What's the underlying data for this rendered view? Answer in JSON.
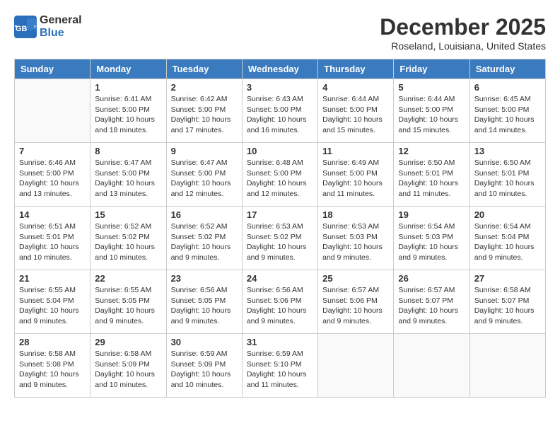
{
  "logo": {
    "general": "General",
    "blue": "Blue"
  },
  "title": {
    "month_year": "December 2025",
    "location": "Roseland, Louisiana, United States"
  },
  "headers": [
    "Sunday",
    "Monday",
    "Tuesday",
    "Wednesday",
    "Thursday",
    "Friday",
    "Saturday"
  ],
  "weeks": [
    [
      {
        "day": "",
        "sunrise": "",
        "sunset": "",
        "daylight": ""
      },
      {
        "day": "1",
        "sunrise": "Sunrise: 6:41 AM",
        "sunset": "Sunset: 5:00 PM",
        "daylight": "Daylight: 10 hours and 18 minutes."
      },
      {
        "day": "2",
        "sunrise": "Sunrise: 6:42 AM",
        "sunset": "Sunset: 5:00 PM",
        "daylight": "Daylight: 10 hours and 17 minutes."
      },
      {
        "day": "3",
        "sunrise": "Sunrise: 6:43 AM",
        "sunset": "Sunset: 5:00 PM",
        "daylight": "Daylight: 10 hours and 16 minutes."
      },
      {
        "day": "4",
        "sunrise": "Sunrise: 6:44 AM",
        "sunset": "Sunset: 5:00 PM",
        "daylight": "Daylight: 10 hours and 15 minutes."
      },
      {
        "day": "5",
        "sunrise": "Sunrise: 6:44 AM",
        "sunset": "Sunset: 5:00 PM",
        "daylight": "Daylight: 10 hours and 15 minutes."
      },
      {
        "day": "6",
        "sunrise": "Sunrise: 6:45 AM",
        "sunset": "Sunset: 5:00 PM",
        "daylight": "Daylight: 10 hours and 14 minutes."
      }
    ],
    [
      {
        "day": "7",
        "sunrise": "Sunrise: 6:46 AM",
        "sunset": "Sunset: 5:00 PM",
        "daylight": "Daylight: 10 hours and 13 minutes."
      },
      {
        "day": "8",
        "sunrise": "Sunrise: 6:47 AM",
        "sunset": "Sunset: 5:00 PM",
        "daylight": "Daylight: 10 hours and 13 minutes."
      },
      {
        "day": "9",
        "sunrise": "Sunrise: 6:47 AM",
        "sunset": "Sunset: 5:00 PM",
        "daylight": "Daylight: 10 hours and 12 minutes."
      },
      {
        "day": "10",
        "sunrise": "Sunrise: 6:48 AM",
        "sunset": "Sunset: 5:00 PM",
        "daylight": "Daylight: 10 hours and 12 minutes."
      },
      {
        "day": "11",
        "sunrise": "Sunrise: 6:49 AM",
        "sunset": "Sunset: 5:00 PM",
        "daylight": "Daylight: 10 hours and 11 minutes."
      },
      {
        "day": "12",
        "sunrise": "Sunrise: 6:50 AM",
        "sunset": "Sunset: 5:01 PM",
        "daylight": "Daylight: 10 hours and 11 minutes."
      },
      {
        "day": "13",
        "sunrise": "Sunrise: 6:50 AM",
        "sunset": "Sunset: 5:01 PM",
        "daylight": "Daylight: 10 hours and 10 minutes."
      }
    ],
    [
      {
        "day": "14",
        "sunrise": "Sunrise: 6:51 AM",
        "sunset": "Sunset: 5:01 PM",
        "daylight": "Daylight: 10 hours and 10 minutes."
      },
      {
        "day": "15",
        "sunrise": "Sunrise: 6:52 AM",
        "sunset": "Sunset: 5:02 PM",
        "daylight": "Daylight: 10 hours and 10 minutes."
      },
      {
        "day": "16",
        "sunrise": "Sunrise: 6:52 AM",
        "sunset": "Sunset: 5:02 PM",
        "daylight": "Daylight: 10 hours and 9 minutes."
      },
      {
        "day": "17",
        "sunrise": "Sunrise: 6:53 AM",
        "sunset": "Sunset: 5:02 PM",
        "daylight": "Daylight: 10 hours and 9 minutes."
      },
      {
        "day": "18",
        "sunrise": "Sunrise: 6:53 AM",
        "sunset": "Sunset: 5:03 PM",
        "daylight": "Daylight: 10 hours and 9 minutes."
      },
      {
        "day": "19",
        "sunrise": "Sunrise: 6:54 AM",
        "sunset": "Sunset: 5:03 PM",
        "daylight": "Daylight: 10 hours and 9 minutes."
      },
      {
        "day": "20",
        "sunrise": "Sunrise: 6:54 AM",
        "sunset": "Sunset: 5:04 PM",
        "daylight": "Daylight: 10 hours and 9 minutes."
      }
    ],
    [
      {
        "day": "21",
        "sunrise": "Sunrise: 6:55 AM",
        "sunset": "Sunset: 5:04 PM",
        "daylight": "Daylight: 10 hours and 9 minutes."
      },
      {
        "day": "22",
        "sunrise": "Sunrise: 6:55 AM",
        "sunset": "Sunset: 5:05 PM",
        "daylight": "Daylight: 10 hours and 9 minutes."
      },
      {
        "day": "23",
        "sunrise": "Sunrise: 6:56 AM",
        "sunset": "Sunset: 5:05 PM",
        "daylight": "Daylight: 10 hours and 9 minutes."
      },
      {
        "day": "24",
        "sunrise": "Sunrise: 6:56 AM",
        "sunset": "Sunset: 5:06 PM",
        "daylight": "Daylight: 10 hours and 9 minutes."
      },
      {
        "day": "25",
        "sunrise": "Sunrise: 6:57 AM",
        "sunset": "Sunset: 5:06 PM",
        "daylight": "Daylight: 10 hours and 9 minutes."
      },
      {
        "day": "26",
        "sunrise": "Sunrise: 6:57 AM",
        "sunset": "Sunset: 5:07 PM",
        "daylight": "Daylight: 10 hours and 9 minutes."
      },
      {
        "day": "27",
        "sunrise": "Sunrise: 6:58 AM",
        "sunset": "Sunset: 5:07 PM",
        "daylight": "Daylight: 10 hours and 9 minutes."
      }
    ],
    [
      {
        "day": "28",
        "sunrise": "Sunrise: 6:58 AM",
        "sunset": "Sunset: 5:08 PM",
        "daylight": "Daylight: 10 hours and 9 minutes."
      },
      {
        "day": "29",
        "sunrise": "Sunrise: 6:58 AM",
        "sunset": "Sunset: 5:09 PM",
        "daylight": "Daylight: 10 hours and 10 minutes."
      },
      {
        "day": "30",
        "sunrise": "Sunrise: 6:59 AM",
        "sunset": "Sunset: 5:09 PM",
        "daylight": "Daylight: 10 hours and 10 minutes."
      },
      {
        "day": "31",
        "sunrise": "Sunrise: 6:59 AM",
        "sunset": "Sunset: 5:10 PM",
        "daylight": "Daylight: 10 hours and 11 minutes."
      },
      {
        "day": "",
        "sunrise": "",
        "sunset": "",
        "daylight": ""
      },
      {
        "day": "",
        "sunrise": "",
        "sunset": "",
        "daylight": ""
      },
      {
        "day": "",
        "sunrise": "",
        "sunset": "",
        "daylight": ""
      }
    ]
  ]
}
